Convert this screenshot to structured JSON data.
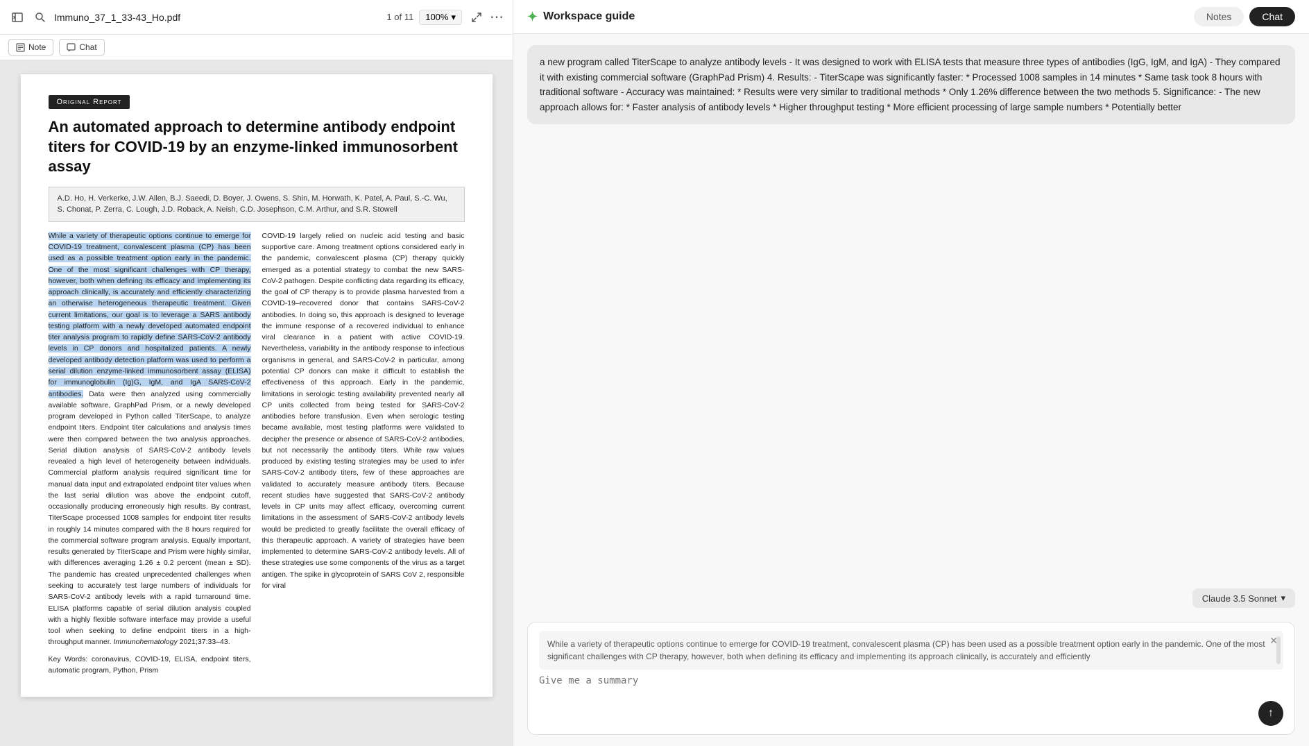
{
  "pdf_panel": {
    "filename": "Immuno_37_1_33-43_Ho.pdf",
    "page_info": "1 of 11",
    "zoom": "100%",
    "zoom_dropdown": "▾",
    "note_btn": "Note",
    "chat_btn": "Chat",
    "original_report": "Original Report",
    "paper_title": "An automated approach to determine antibody endpoint titers for COVID-19 by an enzyme-linked immunosorbent assay",
    "authors": "A.D. Ho, H. Verkerke, J.W. Allen, B.J. Saeedi, D. Boyer, J. Owens, S. Shin, M. Horwath, K. Patel, A. Paul, S.-C. Wu, S. Chonat, P. Zerra, C. Lough, J.D. Roback, A. Neish, C.D. Josephson, C.M. Arthur, and S.R. Stowell",
    "left_col_text": "While a variety of therapeutic options continue to emerge for COVID-19 treatment, convalescent plasma (CP) has been used as a possible treatment option early in the pandemic. One of the most significant challenges with CP therapy, however, both when defining its efficacy and implementing its approach clinically, is accurately and efficiently characterizing an otherwise heterogeneous therapeutic treatment. Given current limitations, our goal is to leverage a SARS antibody testing platform with a newly developed automated endpoint titer analysis program to rapidly define SARS-CoV-2 antibody levels in CP donors and hospitalized patients. A newly developed antibody detection platform was used to perform a serial dilution enzyme-linked immunosorbent assay (ELISA) for immunoglobulin (Ig)G, IgM, and IgA SARS-CoV-2 antibodies. Data were then analyzed using commercially available software, GraphPad Prism, or a newly developed program developed in Python called TiterScape, to analyze endpoint titers. Endpoint titer calculations and analysis times were then compared between the two analysis approaches. Serial dilution analysis of SARS-CoV-2 antibody levels revealed a high level of heterogeneity between individuals. Commercial platform analysis required significant time for manual data input and extrapolated endpoint titer values when the last serial dilution was above the endpoint cutoff, occasionally producing erroneously high results. By contrast, TiterScape processed 1008 samples for endpoint titer results in roughly 14 minutes compared with the 8 hours required for the commercial software program analysis. Equally important, results generated by TiterScape and Prism were highly similar, with differences averaging 1.26 ± 0.2 percent (mean ± SD). The pandemic has created unprecedented challenges when seeking to accurately test large numbers of individuals for SARS-CoV-2 antibody levels with a rapid turnaround time. ELISA platforms capable of serial dilution analysis coupled with a highly flexible software interface may provide a useful tool when seeking to define endpoint titers in a high-throughput manner. Immunohematology 2021;37:33–43.",
    "right_col_text": "COVID-19 largely relied on nucleic acid testing and basic supportive care. Among treatment options considered early in the pandemic, convalescent plasma (CP) therapy quickly emerged as a potential strategy to combat the new SARS-CoV-2 pathogen. Despite conflicting data regarding its efficacy, the goal of CP therapy is to provide plasma harvested from a COVID-19–recovered donor that contains SARS-CoV-2 antibodies. In doing so, this approach is designed to leverage the immune response of a recovered individual to enhance viral clearance in a patient with active COVID-19. Nevertheless, variability in the antibody response to infectious organisms in general, and SARS-CoV-2 in particular, among potential CP donors can make it difficult to establish the effectiveness of this approach. Early in the pandemic, limitations in serologic testing availability prevented nearly all CP units collected from being tested for SARS-CoV-2 antibodies before transfusion. Even when serologic testing became available, most testing platforms were validated to decipher the presence or absence of SARS-CoV-2 antibodies, but not necessarily the antibody titers. While raw values produced by existing testing strategies may be used to infer SARS-CoV-2 antibody titers, few of these approaches are validated to accurately measure antibody titers. Because recent studies have suggested that SARS-CoV-2 antibody levels in CP units may affect efficacy, overcoming current limitations in the assessment of SARS-CoV-2 antibody levels would be predicted to greatly facilitate the overall efficacy of this therapeutic approach. A variety of strategies have been implemented to determine SARS-CoV-2 antibody levels. All of these strategies use some components of the virus as a target antigen. The spike in glycoprotein of SARS CoV 2, responsible for viral",
    "keywords": "Key Words: coronavirus, COVID-19, ELISA, endpoint titers, automatic program, Python, Prism"
  },
  "chat_panel": {
    "workspace_guide_label": "Workspace guide",
    "notes_tab": "Notes",
    "chat_tab": "Chat",
    "active_tab": "chat",
    "message_content": "a new program called TiterScape to analyze antibody levels - It was designed to work with ELISA tests that measure three types of antibodies (IgG, IgM, and IgA) - They compared it with existing commercial software (GraphPad Prism) 4. Results: - TiterScape was significantly faster: * Processed 1008 samples in 14 minutes * Same task took 8 hours with traditional software - Accuracy was maintained: * Results were very similar to traditional methods * Only 1.26% difference between the two methods 5. Significance: - The new approach allows for: * Faster analysis of antibody levels * Higher throughput testing * More efficient processing of large sample numbers * Potentially better",
    "model_selector_label": "Claude 3.5 Sonnet",
    "model_dropdown_arrow": "▾",
    "quoted_text": "While a variety of therapeutic options continue to emerge for COVID-19 treatment, convalescent plasma (CP) has been used as a possible treatment option early in the pandemic. One of the most significant challenges with CP therapy, however, both when defining its efficacy and implementing its approach clinically, is accurately and efficiently",
    "input_placeholder": "Give me a summary",
    "send_icon": "↑",
    "close_icon": "✕"
  },
  "icons": {
    "chevrons_left": "«",
    "sidebar_icon": "⊞",
    "search_icon": "🔍",
    "expand_icon": "⤢",
    "more_icon": "•••",
    "note_icon": "📄",
    "chat_icon": "💬",
    "spark_icon": "✦"
  }
}
